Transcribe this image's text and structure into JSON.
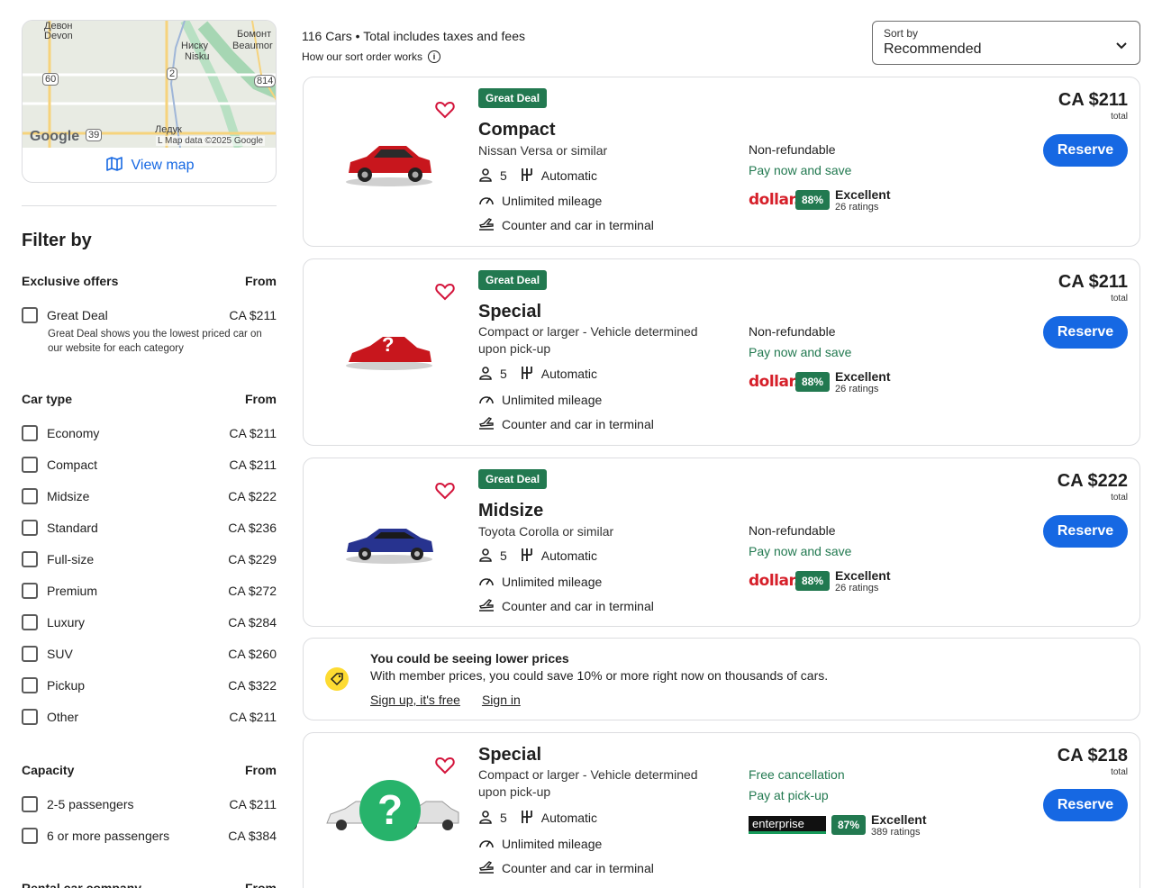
{
  "map": {
    "labels": {
      "devon_ru": "Девон",
      "devon": "Devon",
      "beaumont_ru": "Бомонт",
      "beaumont": "Beaumor",
      "nisku_ru": "Ниску",
      "nisku": "Nisku",
      "leduc_ru": "Ледук",
      "leduc": "L",
      "road_60": "60",
      "road_2": "2",
      "road_814": "814",
      "road_39": "39"
    },
    "brand": "Google",
    "credit": "Map data ©2025 Google",
    "view_map": "View map"
  },
  "filters": {
    "title": "Filter by",
    "exclusive": {
      "header": "Exclusive offers",
      "from": "From",
      "items": [
        {
          "label": "Great Deal",
          "price": "CA $211",
          "note": "Great Deal shows you the lowest priced car on our website for each category"
        }
      ]
    },
    "car_type": {
      "header": "Car type",
      "from": "From",
      "items": [
        {
          "label": "Economy",
          "price": "CA $211"
        },
        {
          "label": "Compact",
          "price": "CA $211"
        },
        {
          "label": "Midsize",
          "price": "CA $222"
        },
        {
          "label": "Standard",
          "price": "CA $236"
        },
        {
          "label": "Full-size",
          "price": "CA $229"
        },
        {
          "label": "Premium",
          "price": "CA $272"
        },
        {
          "label": "Luxury",
          "price": "CA $284"
        },
        {
          "label": "SUV",
          "price": "CA $260"
        },
        {
          "label": "Pickup",
          "price": "CA $322"
        },
        {
          "label": "Other",
          "price": "CA $211"
        }
      ]
    },
    "capacity": {
      "header": "Capacity",
      "from": "From",
      "items": [
        {
          "label": "2-5 passengers",
          "price": "CA $211"
        },
        {
          "label": "6 or more passengers",
          "price": "CA $384"
        }
      ]
    },
    "rental_company": {
      "header": "Rental car company",
      "from": "From"
    }
  },
  "results": {
    "summary": "116 Cars • Total includes taxes and fees",
    "sort_info": "How our sort order works",
    "sort_label": "Sort by",
    "sort_value": "Recommended"
  },
  "cards": [
    {
      "badge": "Great Deal",
      "title": "Compact",
      "subtitle": "Nissan Versa or similar",
      "seats": "5",
      "transmission": "Automatic",
      "mileage": "Unlimited mileage",
      "pickup": "Counter and car in terminal",
      "policy": "Non-refundable",
      "payment": "Pay now and save",
      "vendor": "dollar.",
      "score": "88%",
      "rating": "Excellent",
      "rating_count": "26 ratings",
      "price": "CA $211",
      "price_note": "total",
      "reserve": "Reserve",
      "car_color": "#c8161d"
    },
    {
      "badge": "Great Deal",
      "title": "Special",
      "subtitle": "Compact or larger - Vehicle determined upon pick-up",
      "seats": "5",
      "transmission": "Automatic",
      "mileage": "Unlimited mileage",
      "pickup": "Counter and car in terminal",
      "policy": "Non-refundable",
      "payment": "Pay now and save",
      "vendor": "dollar.",
      "score": "88%",
      "rating": "Excellent",
      "rating_count": "26 ratings",
      "price": "CA $211",
      "price_note": "total",
      "reserve": "Reserve",
      "mystery_mark": "?"
    },
    {
      "badge": "Great Deal",
      "title": "Midsize",
      "subtitle": "Toyota Corolla or similar",
      "seats": "5",
      "transmission": "Automatic",
      "mileage": "Unlimited mileage",
      "pickup": "Counter and car in terminal",
      "policy": "Non-refundable",
      "payment": "Pay now and save",
      "vendor": "dollar.",
      "score": "88%",
      "rating": "Excellent",
      "rating_count": "26 ratings",
      "price": "CA $222",
      "price_note": "total",
      "reserve": "Reserve",
      "car_color": "#27338f"
    },
    {
      "title": "Special",
      "subtitle": "Compact or larger - Vehicle determined upon pick-up",
      "seats": "5",
      "transmission": "Automatic",
      "mileage": "Unlimited mileage",
      "pickup": "Counter and car in terminal",
      "policy": "Free cancellation",
      "payment": "Pay at pick-up",
      "vendor": "enterprise",
      "score": "87%",
      "rating": "Excellent",
      "rating_count": "389 ratings",
      "price": "CA $218",
      "price_note": "total",
      "reserve": "Reserve",
      "mystery_mark": "?"
    }
  ],
  "promo": {
    "title": "You could be seeing lower prices",
    "text": "With member prices, you could save 10% or more right now on thousands of cars.",
    "signup": "Sign up, it's free",
    "signin": "Sign in"
  },
  "colors": {
    "accent": "#1668e3",
    "deal": "#227950",
    "heart": "#d3133a"
  }
}
